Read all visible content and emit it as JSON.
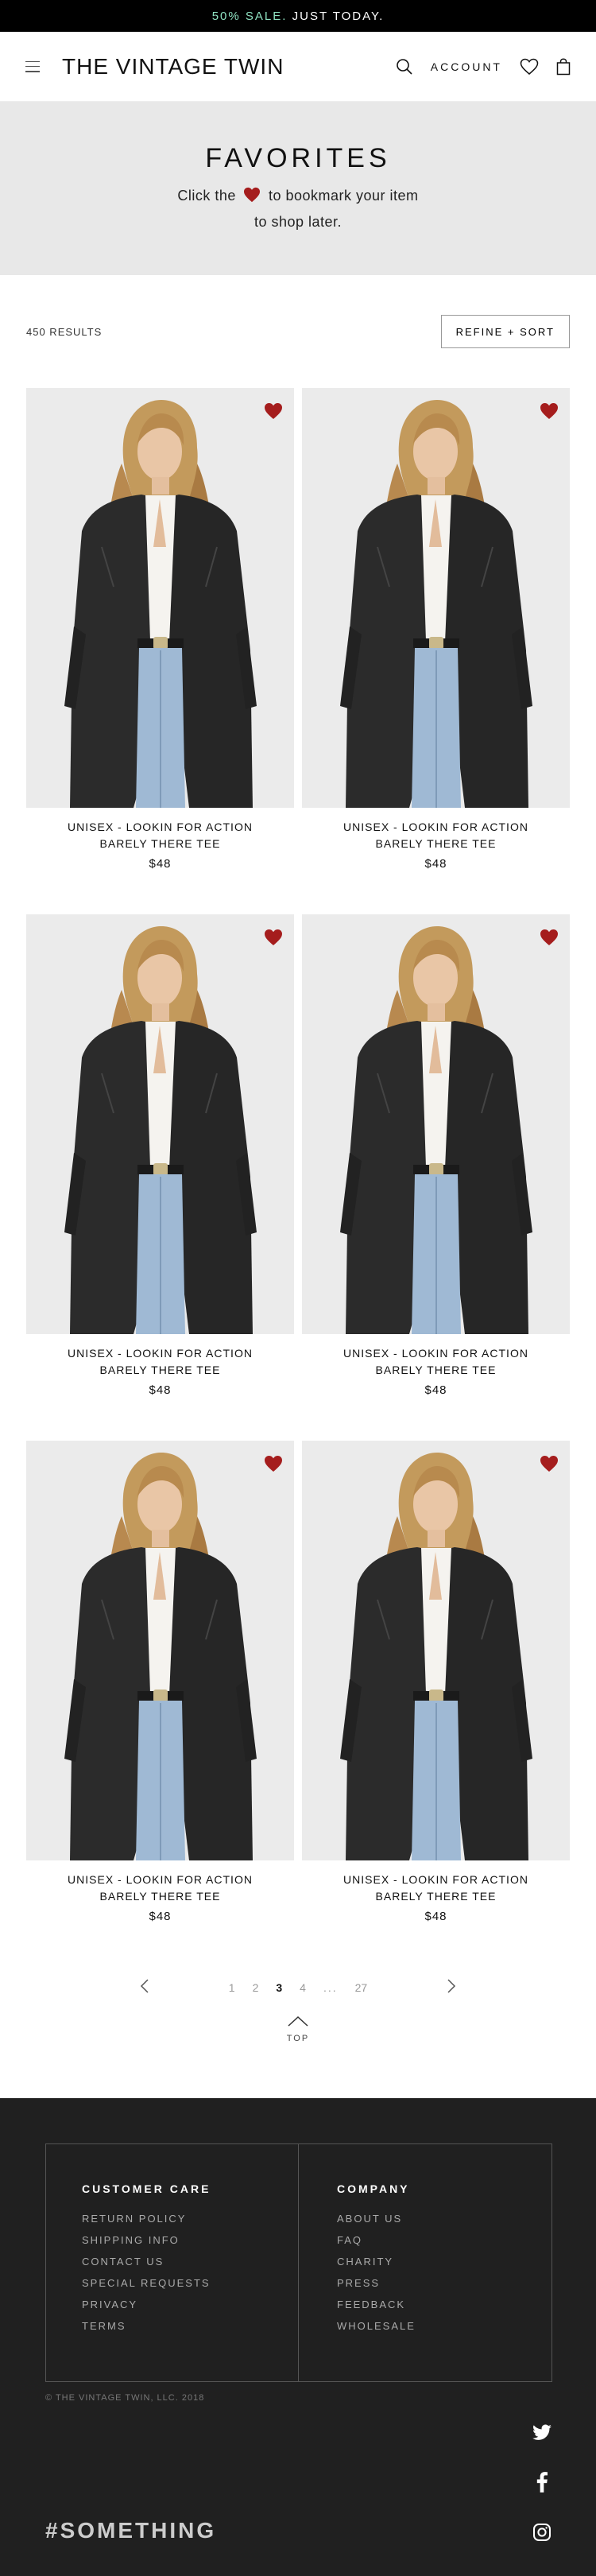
{
  "promo": {
    "highlight": "50% SALE.",
    "text": " JUST TODAY.",
    "accent_color": "#8ee0c0"
  },
  "header": {
    "logo": "THE VINTAGE TWIN",
    "account_label": "ACCOUNT"
  },
  "hero": {
    "title": "FAVORITES",
    "line1_before": "Click the",
    "line1_after": "to bookmark your item",
    "line2": "to shop later.",
    "heart_color": "#a51d1d"
  },
  "results": {
    "count": "450 RESULTS",
    "refine_label": "REFINE + SORT"
  },
  "products": [
    {
      "title": "UNISEX - LOOKIN FOR ACTION BARELY THERE TEE",
      "price": "$48"
    },
    {
      "title": "UNISEX - LOOKIN FOR ACTION BARELY THERE TEE",
      "price": "$48"
    },
    {
      "title": "UNISEX - LOOKIN FOR ACTION BARELY THERE TEE",
      "price": "$48"
    },
    {
      "title": "UNISEX - LOOKIN FOR ACTION BARELY THERE TEE",
      "price": "$48"
    },
    {
      "title": "UNISEX - LOOKIN FOR ACTION BARELY THERE TEE",
      "price": "$48"
    },
    {
      "title": "UNISEX - LOOKIN FOR ACTION BARELY THERE TEE",
      "price": "$48"
    }
  ],
  "pagination": {
    "pages": [
      "1",
      "2",
      "3",
      "4",
      "...",
      "27"
    ],
    "current": "3"
  },
  "top": {
    "label": "TOP"
  },
  "footer": {
    "customer_care": {
      "heading": "CUSTOMER CARE",
      "links": [
        "RETURN POLICY",
        "SHIPPING INFO",
        "CONTACT US",
        "SPECIAL REQUESTS",
        "PRIVACY",
        "TERMS"
      ]
    },
    "company": {
      "heading": "COMPANY",
      "links": [
        "ABOUT US",
        "FAQ",
        "CHARITY",
        "PRESS",
        "FEEDBACK",
        "WHOLESALE"
      ]
    },
    "copyright": "© THE VINTAGE TWIN, LLC. 2018",
    "hashtag": "#SOMETHING"
  },
  "icons": {
    "menu": "hamburger-menu-icon",
    "search": "search-icon",
    "wishlist": "heart-outline-icon",
    "bag": "shopping-bag-icon",
    "favorite": "heart-filled-icon",
    "prev": "chevron-left-icon",
    "next": "chevron-right-icon",
    "top": "chevron-up-icon",
    "twitter": "twitter-icon",
    "facebook": "facebook-icon",
    "instagram": "instagram-icon"
  }
}
